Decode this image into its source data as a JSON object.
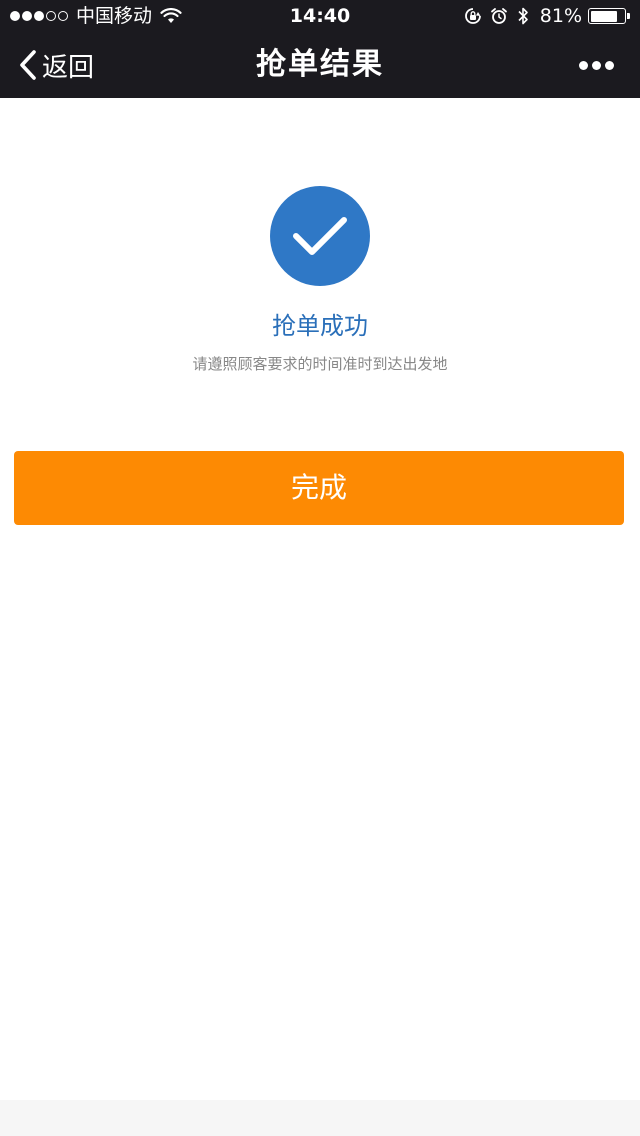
{
  "status_bar": {
    "carrier": "中国移动",
    "time": "14:40",
    "battery_percent": "81%",
    "battery_level": 0.81,
    "signal_bars_filled": 3,
    "signal_bars_total": 5,
    "icons": [
      "wifi-icon",
      "orientation-lock-icon",
      "alarm-icon",
      "bluetooth-icon",
      "battery-icon"
    ]
  },
  "navbar": {
    "back_label": "返回",
    "title": "抢单结果",
    "back_icon": "chevron-left-icon",
    "more_icon": "more-dots-icon"
  },
  "result": {
    "icon": "check-circle-icon",
    "title": "抢单成功",
    "subtitle": "请遵照顾客要求的时间准时到达出发地"
  },
  "actions": {
    "done_label": "完成"
  },
  "colors": {
    "header_bg": "#1b1a1f",
    "accent_blue": "#2f78c6",
    "title_blue": "#2a6fb9",
    "button_orange": "#fd8a03",
    "subtitle_gray": "#888888"
  }
}
